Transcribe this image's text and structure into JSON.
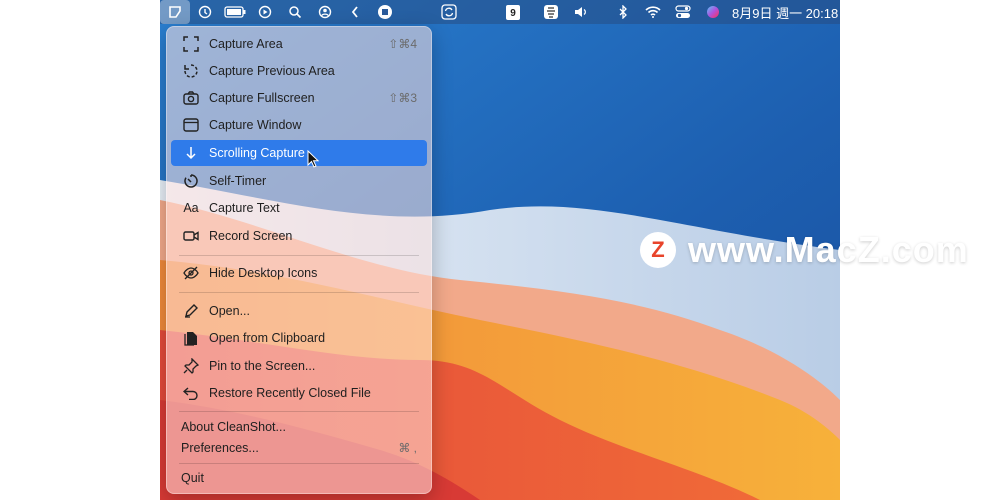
{
  "menubar": {
    "icons": [
      "cleanshot-icon",
      "history-icon",
      "battery-icon",
      "play-icon",
      "search-icon",
      "user-icon",
      "chevron-left-icon",
      "stop-icon",
      "sync-icon",
      "calendar-icon",
      "app-icon",
      "volume-icon",
      "bluetooth-icon",
      "wifi-icon",
      "control-center-icon",
      "siri-icon"
    ],
    "calendar_day": "9",
    "clock": "8月9日 週一  20:18"
  },
  "menu": {
    "items": [
      {
        "label": "Capture Area",
        "shortcut": "⇧⌘4",
        "icon": "capture-area-icon"
      },
      {
        "label": "Capture Previous Area",
        "shortcut": "",
        "icon": "previous-area-icon"
      },
      {
        "label": "Capture Fullscreen",
        "shortcut": "⇧⌘3",
        "icon": "camera-icon"
      },
      {
        "label": "Capture Window",
        "shortcut": "",
        "icon": "window-icon"
      },
      {
        "label": "Scrolling Capture",
        "shortcut": "",
        "icon": "arrow-down-icon"
      },
      {
        "label": "Self-Timer",
        "shortcut": "",
        "icon": "timer-icon"
      },
      {
        "label": "Capture Text",
        "shortcut": "",
        "icon": "text-icon",
        "glyph": "Aa"
      },
      {
        "label": "Record Screen",
        "shortcut": "",
        "icon": "video-camera-icon"
      },
      {
        "label": "Hide Desktop Icons",
        "shortcut": "",
        "icon": "eye-slash-icon"
      },
      {
        "label": "Open...",
        "shortcut": "",
        "icon": "pen-icon"
      },
      {
        "label": "Open from Clipboard",
        "shortcut": "",
        "icon": "clipboard-icon"
      },
      {
        "label": "Pin to the Screen...",
        "shortcut": "",
        "icon": "pin-icon"
      },
      {
        "label": "Restore Recently Closed File",
        "shortcut": "",
        "icon": "restore-icon"
      },
      {
        "label": "About CleanShot...",
        "shortcut": ""
      },
      {
        "label": "Preferences...",
        "shortcut": "⌘ ,"
      },
      {
        "label": "Quit",
        "shortcut": ""
      }
    ],
    "highlighted": "Scrolling Capture"
  },
  "watermark": {
    "badge": "Z",
    "text": "www.MacZ.com"
  },
  "colors": {
    "highlight": "#2f7bea",
    "accent_red": "#e8442b"
  }
}
